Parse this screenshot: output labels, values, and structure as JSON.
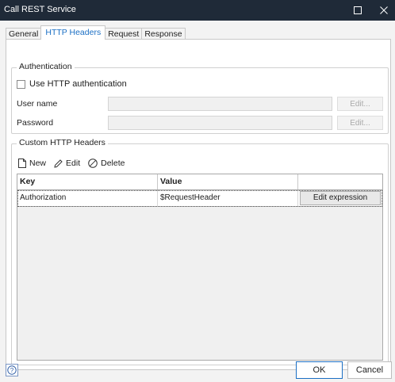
{
  "window": {
    "title": "Call REST Service"
  },
  "tabs": [
    {
      "label": "General"
    },
    {
      "label": "HTTP Headers"
    },
    {
      "label": "Request"
    },
    {
      "label": "Response"
    }
  ],
  "authentication": {
    "group_title": "Authentication",
    "use_http_auth_label": "Use HTTP authentication",
    "use_http_auth_checked": false,
    "username_label": "User name",
    "username_value": "",
    "password_label": "Password",
    "password_value": "",
    "edit_label": "Edit..."
  },
  "custom_headers": {
    "group_title": "Custom HTTP Headers",
    "toolbar": {
      "new_label": "New",
      "edit_label": "Edit",
      "delete_label": "Delete"
    },
    "columns": {
      "key": "Key",
      "value": "Value"
    },
    "rows": [
      {
        "key": "Authorization",
        "value": "$RequestHeader",
        "action_label": "Edit expression"
      }
    ]
  },
  "footer": {
    "ok_label": "OK",
    "cancel_label": "Cancel"
  },
  "colors": {
    "titlebar": "#1f2a38",
    "accent": "#1b6fc4"
  }
}
